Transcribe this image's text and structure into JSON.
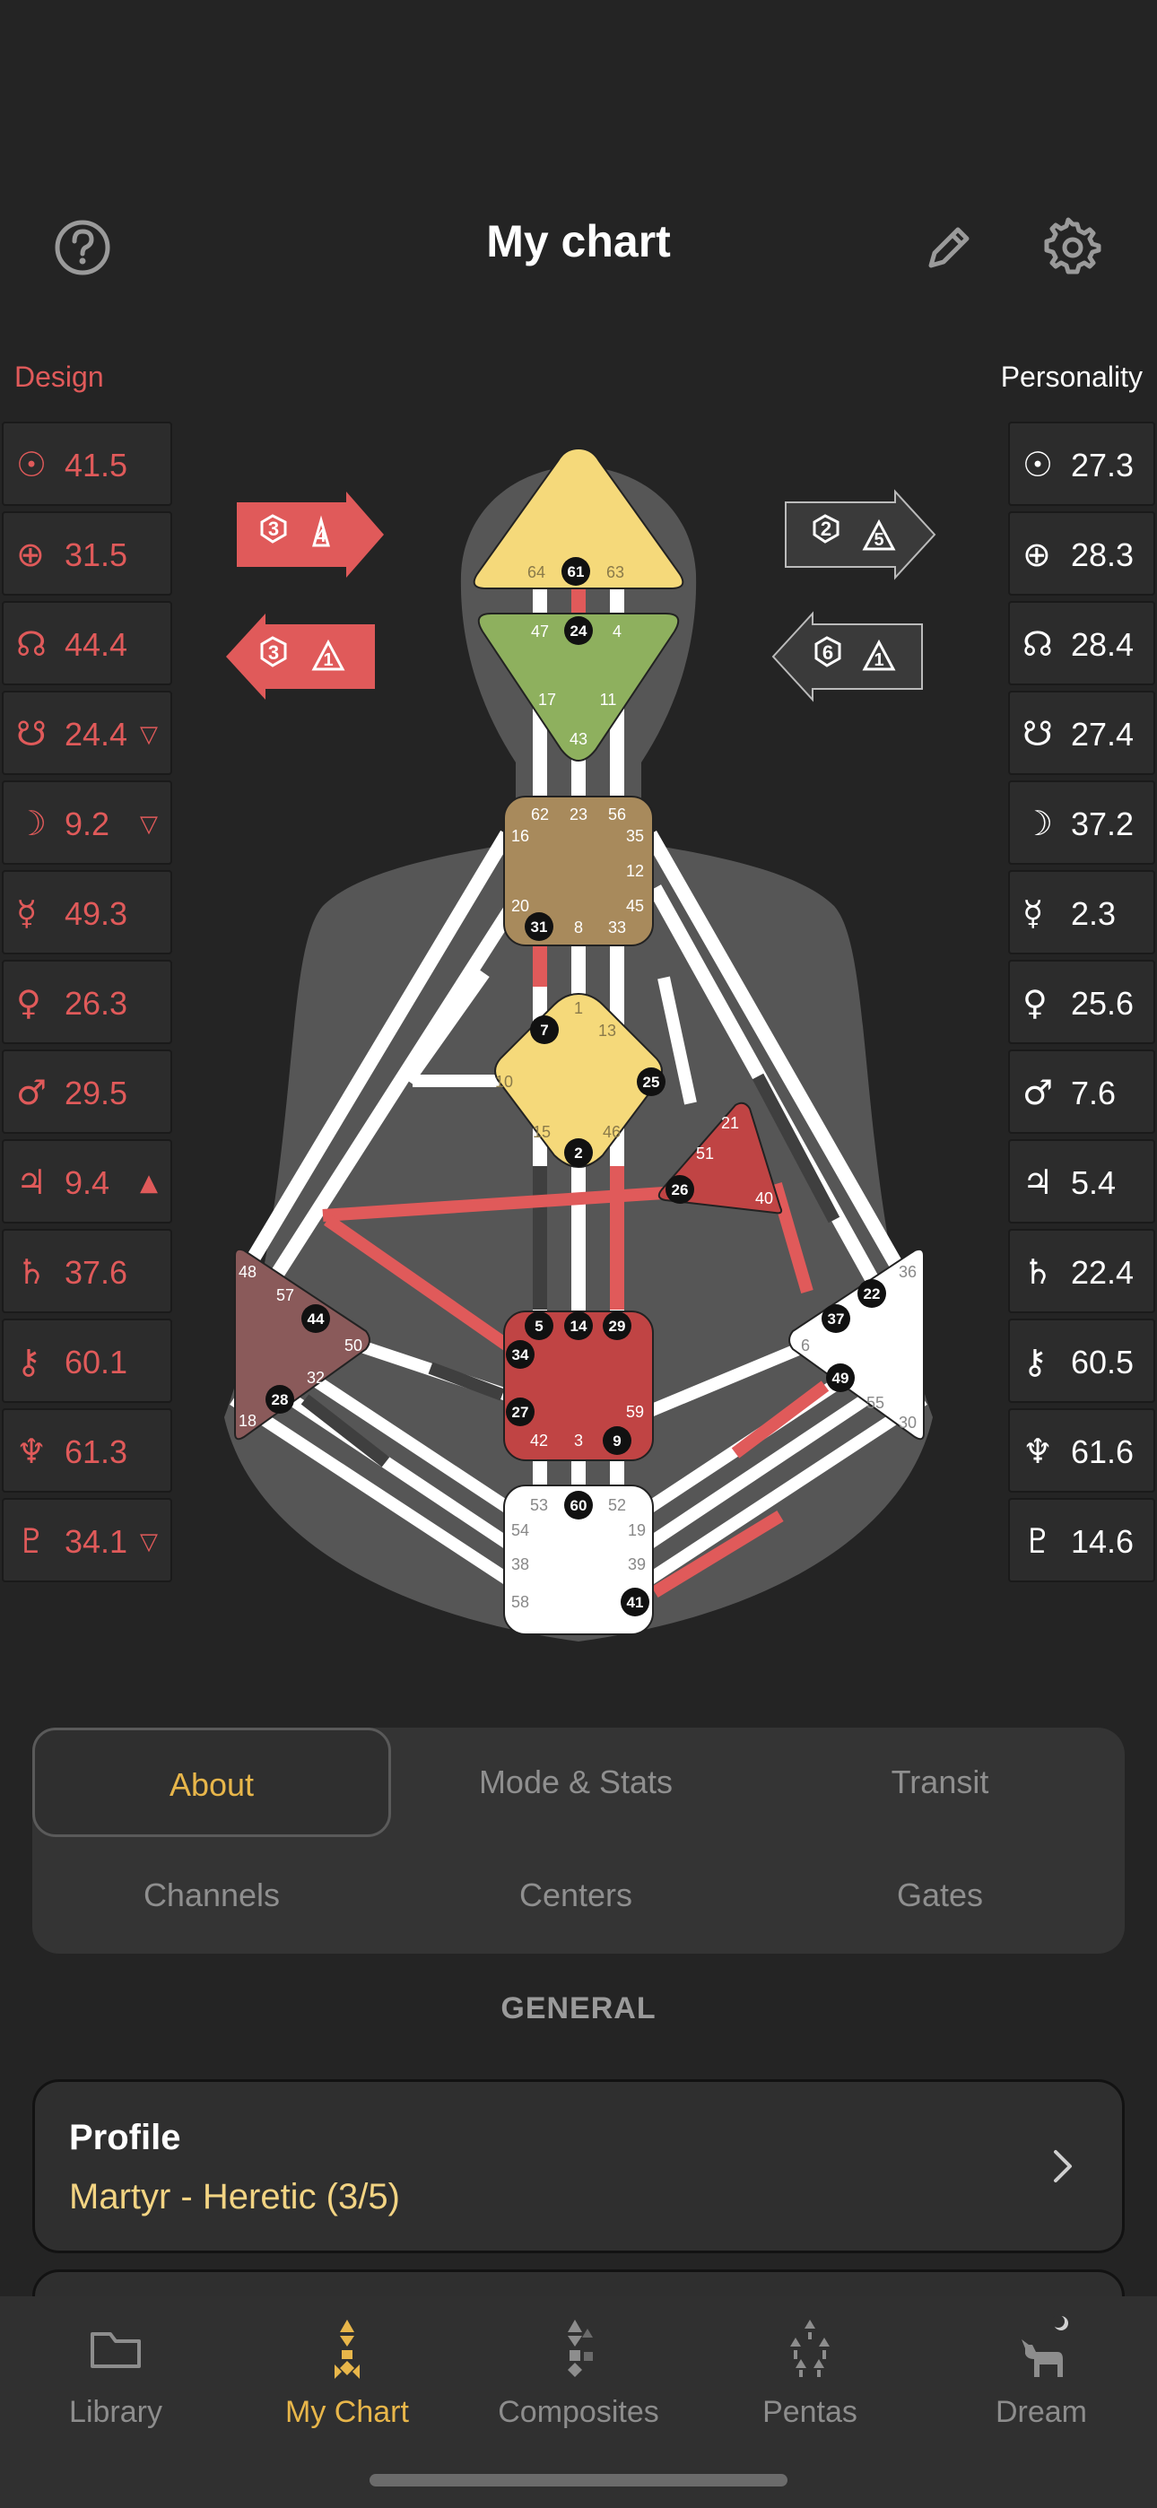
{
  "header": {
    "title": "My chart"
  },
  "icons": {
    "help": "question-circle-icon",
    "edit": "pencil-icon",
    "settings": "gear-icon"
  },
  "colors": {
    "design": "#e05a5a",
    "personality": "#ffffff",
    "accent": "#e8b64a",
    "profile_value": "#f3d483"
  },
  "design": {
    "label": "Design",
    "rows": [
      {
        "planet": "sun",
        "symbol": "☉",
        "value": "41.5",
        "mark": ""
      },
      {
        "planet": "earth",
        "symbol": "⊕",
        "value": "31.5",
        "mark": ""
      },
      {
        "planet": "north-node",
        "symbol": "☊",
        "value": "44.4",
        "mark": ""
      },
      {
        "planet": "south-node",
        "symbol": "☋",
        "value": "24.4",
        "mark": "▽"
      },
      {
        "planet": "moon",
        "symbol": "☽",
        "value": "9.2",
        "mark": "▽"
      },
      {
        "planet": "mercury",
        "symbol": "☿",
        "value": "49.3",
        "mark": ""
      },
      {
        "planet": "venus",
        "symbol": "♀",
        "value": "26.3",
        "mark": ""
      },
      {
        "planet": "mars",
        "symbol": "♂",
        "value": "29.5",
        "mark": ""
      },
      {
        "planet": "jupiter",
        "symbol": "♃",
        "value": "9.4",
        "mark": "▲"
      },
      {
        "planet": "saturn",
        "symbol": "♄",
        "value": "37.6",
        "mark": ""
      },
      {
        "planet": "chiron",
        "symbol": "⚷",
        "value": "60.1",
        "mark": ""
      },
      {
        "planet": "neptune",
        "symbol": "♆",
        "value": "61.3",
        "mark": ""
      },
      {
        "planet": "pluto",
        "symbol": "♇",
        "value": "34.1",
        "mark": "▽"
      }
    ]
  },
  "personality": {
    "label": "Personality",
    "rows": [
      {
        "planet": "sun",
        "symbol": "☉",
        "value": "27.3"
      },
      {
        "planet": "earth",
        "symbol": "⊕",
        "value": "28.3"
      },
      {
        "planet": "north-node",
        "symbol": "☊",
        "value": "28.4"
      },
      {
        "planet": "south-node",
        "symbol": "☋",
        "value": "27.4"
      },
      {
        "planet": "moon",
        "symbol": "☽",
        "value": "37.2"
      },
      {
        "planet": "mercury",
        "symbol": "☿",
        "value": "2.3"
      },
      {
        "planet": "venus",
        "symbol": "♀",
        "value": "25.6"
      },
      {
        "planet": "mars",
        "symbol": "♂",
        "value": "7.6"
      },
      {
        "planet": "jupiter",
        "symbol": "♃",
        "value": "5.4"
      },
      {
        "planet": "saturn",
        "symbol": "♄",
        "value": "22.4"
      },
      {
        "planet": "chiron",
        "symbol": "⚷",
        "value": "60.5"
      },
      {
        "planet": "neptune",
        "symbol": "♆",
        "value": "61.6"
      },
      {
        "planet": "pluto",
        "symbol": "♇",
        "value": "14.6"
      }
    ]
  },
  "arrows": {
    "design_top": {
      "line": "3",
      "tone": "4"
    },
    "design_bottom": {
      "line": "3",
      "tone": "1"
    },
    "personality_top": {
      "line": "2",
      "tone": "5"
    },
    "personality_bottom": {
      "line": "6",
      "tone": "1"
    }
  },
  "gates": {
    "head": [
      "64",
      "61",
      "63"
    ],
    "ajna": [
      "47",
      "24",
      "4",
      "17",
      "11",
      "43"
    ],
    "throat": [
      "62",
      "23",
      "56",
      "16",
      "35",
      "12",
      "20",
      "45",
      "31",
      "8",
      "33"
    ],
    "g_center": [
      "1",
      "7",
      "13",
      "10",
      "25",
      "15",
      "46",
      "2"
    ],
    "ego": [
      "21",
      "51",
      "26",
      "40"
    ],
    "spleen": [
      "48",
      "57",
      "44",
      "50",
      "32",
      "28",
      "18"
    ],
    "sacral": [
      "5",
      "14",
      "29",
      "34",
      "27",
      "59",
      "42",
      "3",
      "9"
    ],
    "solar_plexus": [
      "36",
      "22",
      "37",
      "6",
      "49",
      "55",
      "30"
    ],
    "root": [
      "53",
      "60",
      "52",
      "54",
      "19",
      "38",
      "39",
      "58",
      "41"
    ]
  },
  "tabs": {
    "about": "About",
    "mode_stats": "Mode & Stats",
    "transit": "Transit",
    "channels": "Channels",
    "centers": "Centers",
    "gates": "Gates"
  },
  "section": {
    "general": "GENERAL"
  },
  "profile": {
    "title": "Profile",
    "value": "Martyr - Heretic (3/5)"
  },
  "nav": {
    "library": "Library",
    "my_chart": "My Chart",
    "composites": "Composites",
    "pentas": "Pentas",
    "dream": "Dream"
  }
}
